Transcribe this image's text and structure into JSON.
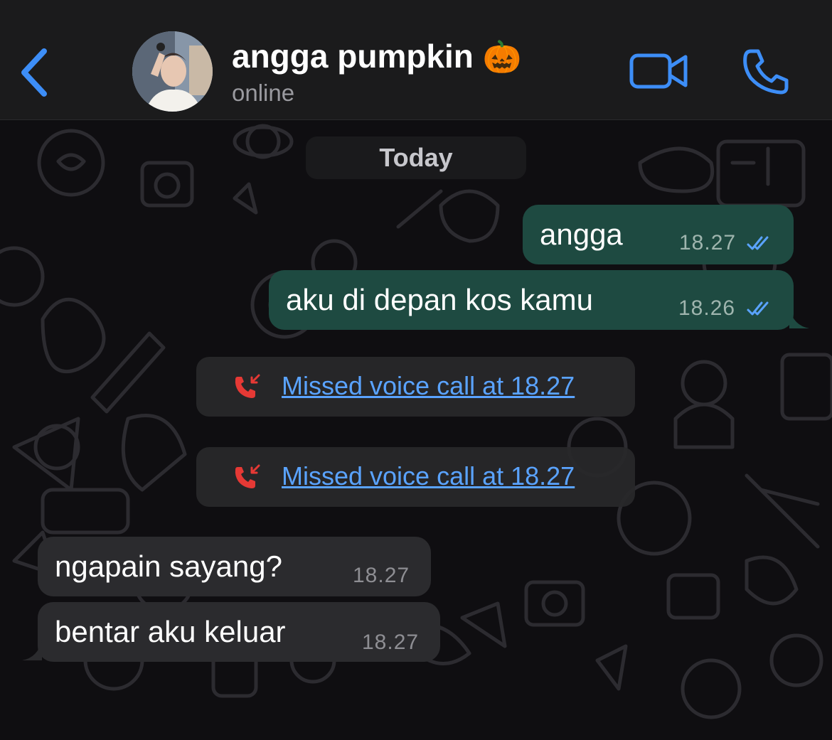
{
  "header": {
    "contact_name": "angga pumpkin",
    "name_emoji": "🎃",
    "status": "online",
    "accent_color": "#3d8ef7"
  },
  "chat": {
    "date_separator": "Today",
    "messages": [
      {
        "direction": "outgoing",
        "text": "angga",
        "time": "18.27",
        "read": true
      },
      {
        "direction": "outgoing",
        "text": "aku di depan kos kamu",
        "time": "18.26",
        "read": true
      },
      {
        "type": "missed-call",
        "text": "Missed voice call at 18.27"
      },
      {
        "type": "missed-call",
        "text": "Missed voice call at 18.27"
      },
      {
        "direction": "incoming",
        "text": "ngapain sayang?",
        "time": "18.27"
      },
      {
        "direction": "incoming",
        "text": "bentar aku keluar",
        "time": "18.27"
      }
    ],
    "colors": {
      "outgoing_bubble": "#1e4a41",
      "incoming_bubble": "#2b2b2e",
      "missed_call_icon": "#e53935",
      "link": "#5aa3ff"
    }
  }
}
